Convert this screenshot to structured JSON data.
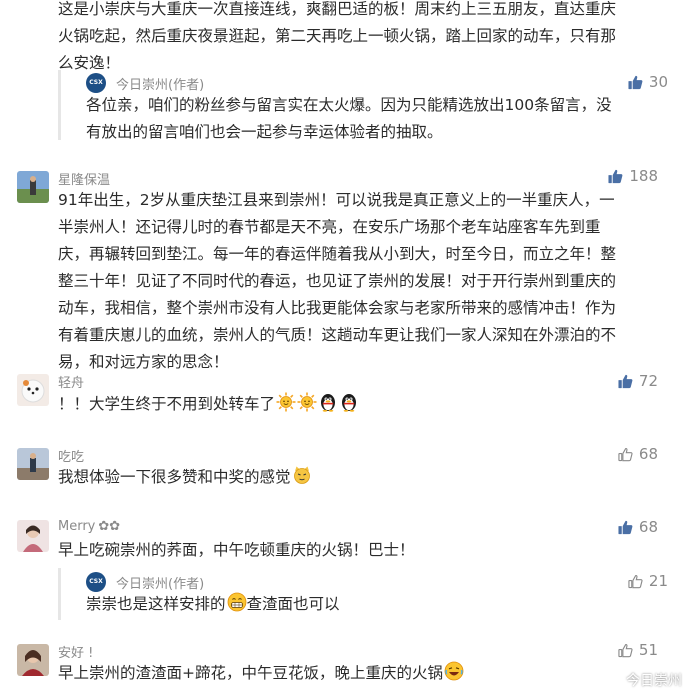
{
  "comments": [
    {
      "text_lines": [
        "这是小崇庆与大重庆一次直接连线，爽翻巴适的板！周末约上三五朋友，直达重庆",
        "火锅吃起，然后重庆夜景逛起，第二天再吃上一顿火锅，踏上回家的动车，只有那",
        "么安逸！"
      ],
      "reply": {
        "author": "今日崇州(作者)",
        "likes": "30",
        "text_lines": [
          "各位亲，咱们的粉丝参与留言实在太火爆。因为只能精选放出100条留言，没",
          "有放出的留言咱们也会一起参与幸运体验者的抽取。"
        ]
      }
    },
    {
      "author": "星隆保温",
      "likes": "188",
      "text_lines": [
        "91年出生，2岁从重庆垫江县来到崇州！可以说我是真正意义上的一半重庆人，一",
        "半崇州人！还记得儿时的春节都是天不亮，在安乐广场那个老车站座客车先到重",
        "庆，再辗转回到垫江。每一年的春运伴随着我从小到大，时至今日，而立之年！整",
        "整三十年！见证了不同时代的春运，也见证了崇州的发展！对于开行崇州到重庆的",
        "动车，我相信，整个崇州市没有人比我更能体会家与老家所带来的感情冲击！作为",
        "有着重庆崽儿的血统，崇州人的气质！这趟动车更让我们一家人深知在外漂泊的不",
        "易，和对远方家的思念！"
      ]
    },
    {
      "author": "轻舟",
      "likes": "72",
      "text": "！！大学生终于不用到处转车了",
      "emojis": [
        "sun-emoji",
        "sun-emoji",
        "penguin-emoji",
        "penguin-emoji"
      ]
    },
    {
      "author": "吃吃",
      "likes": "68",
      "text": "我想体验一下很多赞和中奖的感觉",
      "emojis": [
        "cat-emoji"
      ]
    },
    {
      "author": "Merry",
      "author_suffix": "✿✿",
      "likes": "68",
      "text": "早上吃碗崇州的荞面，中午吃顿重庆的火锅！巴士！",
      "reply": {
        "author": "今日崇州(作者)",
        "likes": "21",
        "text_before": "崇崇也是这样安排的",
        "text_after": "查渣面也可以",
        "emojis": [
          "grin-emoji"
        ]
      }
    },
    {
      "author": "安好 !",
      "likes": "51",
      "text": "早上崇州的渣渣面+蹄花，中午豆花饭，晚上重庆的火锅",
      "emojis": [
        "laugh-emoji"
      ]
    }
  ],
  "logo_text": "CSX",
  "watermark": "今日崇州",
  "colors": {
    "like_filled": "#4a6fa5",
    "like_outline": "#8a8a8a",
    "text": "#2b2b2b",
    "meta": "#8a8a8a"
  }
}
